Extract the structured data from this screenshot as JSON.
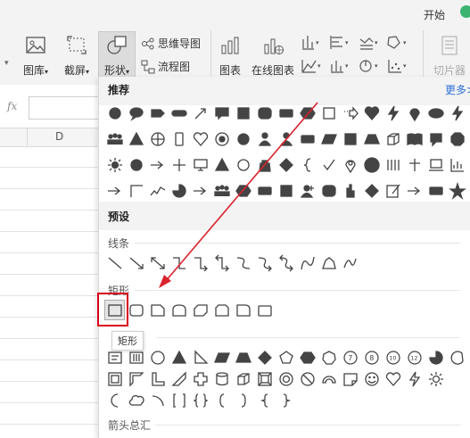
{
  "ribbon": {
    "start_tab": "开始",
    "btn_image_lib": "图库",
    "btn_screenshot": "截屏",
    "btn_shapes": "形状",
    "btn_mindmap": "思维导图",
    "btn_flowchart": "流程图",
    "btn_chart": "图表",
    "btn_online_chart": "在线图表",
    "btn_slicer": "切片器"
  },
  "formula": {
    "fx": "fx"
  },
  "grid": {
    "col_d": "D"
  },
  "panel": {
    "recommended": "推荐",
    "more": "更多",
    "preset": "预设",
    "lines": "线条",
    "rect": "矩形",
    "tooltip": "矩形",
    "arrows": "箭头总汇"
  },
  "accent": {
    "selection": "#d9001b",
    "arrow": "#d9232d",
    "link": "#2d6fd6"
  },
  "icons": {
    "recommended_row1": [
      "circle-icon",
      "ellipse-callout-icon",
      "pentagon-arrow-icon",
      "rounded-bar-icon",
      "diagonal-arrow-icon",
      "speech-rect-icon",
      "square-icon",
      "rounded-square-icon",
      "rect-icon",
      "hexagon-icon",
      "rect-outline-icon",
      "striped-arrow-icon",
      "heart-icon",
      "lightning-icon",
      "drop-pin-icon",
      "ellipse-icon",
      "lightning-icon"
    ],
    "recommended_row2": [
      "people-icon",
      "triangle-icon",
      "globe-icon",
      "phone-icon",
      "heart-outline-icon",
      "target-icon",
      "circle-icon",
      "person-icon",
      "person-icon",
      "rect-icon",
      "parallelogram-icon",
      "square-icon",
      "trapezoid-icon",
      "cube-icon",
      "book-icon",
      "chat-bubble-icon",
      "octagon-icon"
    ],
    "recommended_row3": [
      "sun-icon",
      "circle-icon",
      "arrow-right-icon",
      "plus-icon",
      "monitor-icon",
      "triangle-icon",
      "circle-outline-icon",
      "bag-icon",
      "diamond-icon",
      "brace-icon",
      "check-icon",
      "map-pin-icon",
      "question-icon",
      "bars-icon",
      "cross-icon",
      "laptop-icon",
      "chart-icon"
    ],
    "recommended_row4": [
      "arrow-right-icon",
      "corner-icon",
      "zigzag-icon",
      "pie-icon",
      "arrow-right-icon",
      "people-icon",
      "hexagon-icon",
      "rect-icon",
      "square-icon",
      "person-add-icon",
      "rounded-square-icon",
      "hand-icon",
      "diamond-icon",
      "edit-icon",
      "arrow-right-icon",
      "rect-icon",
      "star-icon"
    ],
    "lines_row": [
      "line-icon",
      "arrow-line-icon",
      "double-arrow-line-icon",
      "elbow-connector-icon",
      "elbow-arrow-icon",
      "elbow-double-arrow-icon",
      "curved-connector-icon",
      "curved-arrow-icon",
      "curved-double-arrow-icon",
      "curve-icon",
      "freeform-icon",
      "scribble-icon"
    ],
    "rect_row": [
      "rectangle-icon",
      "rounded-rectangle-icon",
      "snip-corner-icon",
      "round-top-icon",
      "snip-diagonal-icon",
      "snip-same-side-icon",
      "round-corner-icon",
      "rect-plain-icon"
    ],
    "basic_row1": [
      "text-box-icon",
      "vertical-text-icon",
      "oval-icon",
      "triangle-icon",
      "right-triangle-icon",
      "parallelogram-icon",
      "trapezoid-icon",
      "diamond-icon",
      "pentagon-icon",
      "hexagon-icon",
      "heptagon-icon",
      "number-7-icon",
      "number-8-icon",
      "number-10-icon",
      "number-12-icon",
      "pie-icon",
      "chord-icon",
      "teardrop-icon"
    ],
    "basic_row2": [
      "frame-icon",
      "half-frame-icon",
      "l-shape-icon",
      "diagonal-stripe-icon",
      "plus-shape-icon",
      "can-icon",
      "cube-icon",
      "bevel-icon",
      "donut-icon",
      "no-symbol-icon",
      "block-arc-icon",
      "folded-corner-icon",
      "smiley-icon",
      "heart-outline-icon",
      "lightning-outline-icon",
      "sun-outline-icon"
    ],
    "basic_row3": [
      "moon-icon",
      "cloud-icon",
      "arc-icon",
      "double-bracket-icon",
      "double-brace-icon",
      "left-bracket-icon",
      "right-bracket-icon",
      "left-brace-icon",
      "right-brace-icon"
    ]
  }
}
